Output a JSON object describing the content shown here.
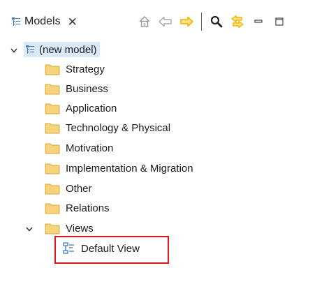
{
  "tab": {
    "title": "Models",
    "close": "✕"
  },
  "toolbar": {
    "buttons": [
      {
        "name": "home-icon"
      },
      {
        "name": "back-icon"
      },
      {
        "name": "forward-icon"
      },
      {
        "name": "search-icon"
      },
      {
        "name": "link-editor-icon"
      },
      {
        "name": "minimize-icon"
      },
      {
        "name": "maximize-icon"
      }
    ]
  },
  "tree": {
    "root": {
      "label": "(new model)",
      "expanded": true,
      "selected": true
    },
    "folders": [
      {
        "label": "Strategy"
      },
      {
        "label": "Business"
      },
      {
        "label": "Application"
      },
      {
        "label": "Technology & Physical"
      },
      {
        "label": "Motivation"
      },
      {
        "label": "Implementation & Migration"
      },
      {
        "label": "Other"
      },
      {
        "label": "Relations"
      },
      {
        "label": "Views",
        "expanded": true
      }
    ],
    "view_item": {
      "label": "Default View",
      "highlighted": true
    }
  },
  "colors": {
    "folder_fill": "#f6d27a",
    "folder_edge": "#d9a93a",
    "selection_bg": "#d9e9f8",
    "highlight_border": "#e0161d",
    "arrow_yellow": "#f2b400",
    "view_icon_blue": "#3b78c4"
  }
}
